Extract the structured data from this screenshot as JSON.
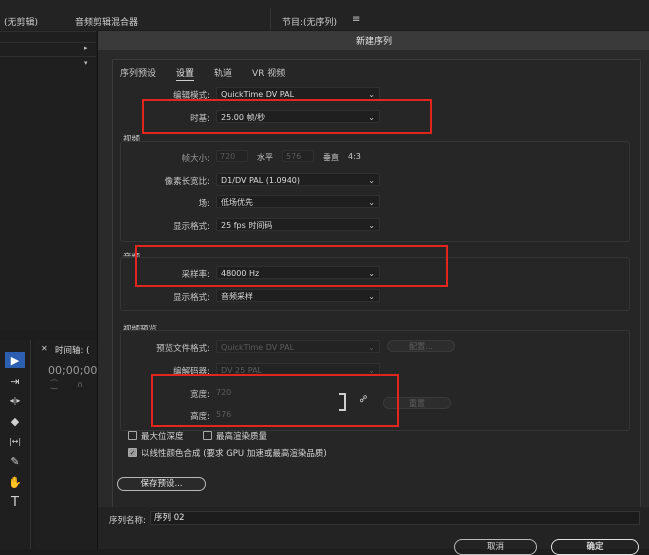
{
  "background": {
    "tab_no_clip": "(无剪辑)",
    "tab_audio_mixer": "音频剪辑混合器",
    "tab_program": "节目:(无序列)",
    "menu_icon": "≡",
    "timeline_label": "时间轴: (",
    "timecode": "00;00;00",
    "tools": [
      "▶",
      "⇥",
      "◂|▸",
      "◆",
      "|↔|",
      "✎",
      "✋",
      "T"
    ]
  },
  "dialog": {
    "title": "新建序列",
    "tabs": [
      "序列预设",
      "设置",
      "轨道",
      "VR 视频"
    ],
    "active_tab": "设置",
    "editing_mode": {
      "label": "编辑模式:",
      "value": "QuickTime DV PAL"
    },
    "timebase": {
      "label": "时基:",
      "value": "25.00  帧/秒"
    },
    "video": {
      "section": "视频",
      "frame_size_label": "帧大小:",
      "frame_width": "720",
      "horizontal_label": "水平",
      "frame_height": "576",
      "vertical_label": "垂直",
      "aspect": "4:3",
      "pixel_aspect": {
        "label": "像素长宽比:",
        "value": "D1/DV PAL (1.0940)"
      },
      "fields": {
        "label": "场:",
        "value": "低场优先"
      },
      "display_format": {
        "label": "显示格式:",
        "value": "25 fps 时间码"
      }
    },
    "audio": {
      "section": "音频",
      "sample_rate": {
        "label": "采样率:",
        "value": "48000 Hz"
      },
      "display_format": {
        "label": "显示格式:",
        "value": "音频采样"
      }
    },
    "preview": {
      "section": "视频预览",
      "file_format": {
        "label": "预览文件格式:",
        "value": "QuickTime DV PAL"
      },
      "config_button": "配置...",
      "codec": {
        "label": "编解码器:",
        "value": "DV 25 PAL"
      },
      "width": {
        "label": "宽度:",
        "value": "720"
      },
      "height": {
        "label": "高度:",
        "value": "576"
      },
      "reset_button": "重置"
    },
    "checkboxes": {
      "max_depth": "最大位深度",
      "max_quality": "最高渲染质量",
      "linear_color": "以线性颜色合成 (要求 GPU 加速或最高渲染品质)"
    },
    "save_preset_button": "保存预设...",
    "sequence_name": {
      "label": "序列名称:",
      "value": "序列 02"
    },
    "cancel_button": "取消",
    "ok_button": "确定"
  },
  "colors": {
    "highlight_box": "#e0261d",
    "dialog_bg": "#2a2a2a"
  }
}
